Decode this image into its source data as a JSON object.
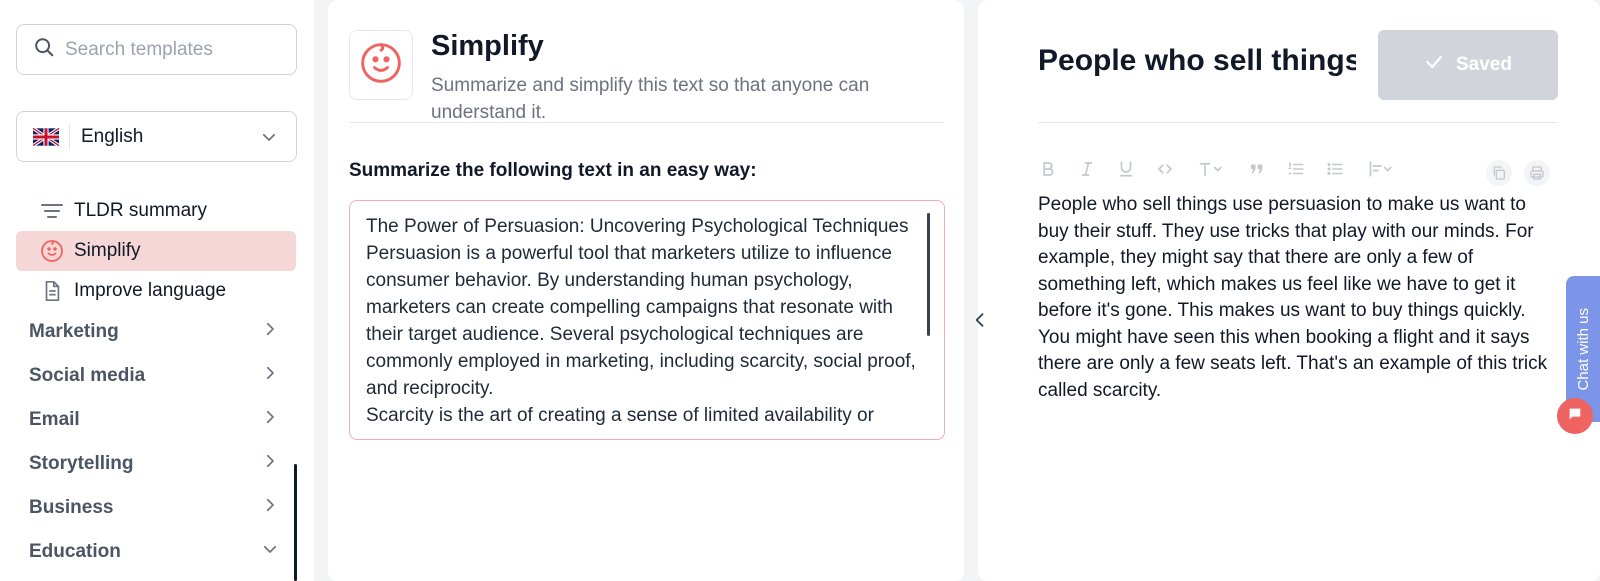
{
  "sidebar": {
    "search": {
      "placeholder": "Search templates"
    },
    "language": {
      "selected": "English",
      "flag_icon": "uk-flag-icon"
    },
    "templates": [
      {
        "label": "TLDR summary",
        "icon": "filter-lines-icon",
        "active": false
      },
      {
        "label": "Simplify",
        "icon": "baby-face-icon",
        "active": true
      },
      {
        "label": "Improve language",
        "icon": "document-icon",
        "active": false
      }
    ],
    "categories": [
      {
        "label": "Marketing",
        "expanded": false
      },
      {
        "label": "Social media",
        "expanded": false
      },
      {
        "label": "Email",
        "expanded": false
      },
      {
        "label": "Storytelling",
        "expanded": false
      },
      {
        "label": "Business",
        "expanded": false
      },
      {
        "label": "Education",
        "expanded": true
      }
    ]
  },
  "template": {
    "title": "Simplify",
    "description": "Summarize and simplify this text so that anyone can understand it.",
    "prompt_label": "Summarize the following text in an easy way:",
    "input_lines": [
      "The Power of Persuasion: Uncovering Psychological Techniques",
      "Persuasion is a powerful tool that marketers utilize to influence consumer behavior. By understanding human psychology, marketers can create compelling campaigns that resonate with their target audience. Several psychological techniques are commonly employed in marketing, including scarcity, social proof, and reciprocity.",
      "Scarcity is the art of creating a sense of limited availability or"
    ]
  },
  "document": {
    "title": "People who sell things use persuasion",
    "saved_label": "Saved",
    "output": "People who sell things use persuasion to make us want to buy their stuff. They use tricks that play with our minds. For example, they might say that there are only a few of something left, which makes us feel like we have to get it before it's gone. This makes us want to buy things quickly. You might have seen this when booking a flight and it says there are only a few seats left. That's an example of this trick called scarcity."
  },
  "chat": {
    "label": "Chat with us"
  },
  "colors": {
    "accent": "#ef6461",
    "active_bg": "#f5d7d7",
    "saved_bg": "#d1d5db",
    "chat_tab": "#7c95e8"
  }
}
